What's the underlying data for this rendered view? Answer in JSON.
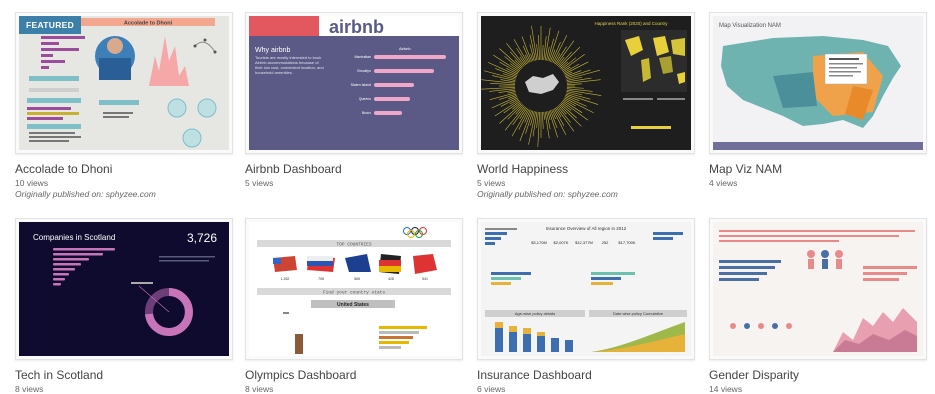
{
  "featured_badge": "FEATURED",
  "cards": [
    {
      "title": "Accolade to Dhoni",
      "views": "10 views",
      "published_label": "Originally published on:",
      "published_site": "sphyzee.com",
      "thumb_text": {
        "heading": "Accolade to Dhoni"
      }
    },
    {
      "title": "Airbnb Dashboard",
      "views": "5 views",
      "thumb_text": {
        "logo": "airbnb",
        "heading": "Why airbnb",
        "body_1": "Tourists are mostly interested to book",
        "body_2": "Airbnb accommodations because of",
        "body_3": "their low cost, convenient location, and",
        "body_4": "household amenities.",
        "chart_title": "Airbnb",
        "bars": [
          "Manhattan",
          "Brooklyn",
          "Staten Island",
          "Queens",
          "Bronx"
        ]
      }
    },
    {
      "title": "World Happiness",
      "views": "5 views",
      "published_label": "Originally published on:",
      "published_site": "sphyzee.com",
      "thumb_text": {
        "heading": "Happiness Rank (2020) and Country"
      }
    },
    {
      "title": "Map Viz NAM",
      "views": "4 views",
      "thumb_text": {
        "heading": "Map Visualization NAM"
      }
    },
    {
      "title": "Tech in Scotland",
      "views": "8 views",
      "thumb_text": {
        "heading": "Companies in Scotland",
        "kpi": "3,726"
      }
    },
    {
      "title": "Olympics Dashboard",
      "views": "8 views",
      "thumb_text": {
        "section_1": "TOP COUNTRIES",
        "section_2": "Find your country stats",
        "country": "United States",
        "medal_counts": [
          "1,262",
          "708",
          "565",
          "428",
          "541"
        ]
      }
    },
    {
      "title": "Insurance Dashboard",
      "views": "6 views",
      "thumb_text": {
        "heading": "Insurance Overview of All region in 2012",
        "panel_1": "Age-wise policy details",
        "panel_2": "Date wise policy Cumulative",
        "kpis": [
          "$3,170M",
          "$2,007K",
          "$12,377M",
          "252",
          "$17,700K"
        ]
      }
    },
    {
      "title": "Gender Disparity",
      "views": "14 views",
      "thumb_text": {}
    }
  ],
  "colors": {
    "badge": "#3c7fa8",
    "airbnb_bg": "#5b5a86",
    "airbnb_bar": "#f0a8c8",
    "happiness_bg": "#1e1e1e",
    "scotland_bg": "#0e0b2e",
    "scotland_accent": "#c874b8"
  }
}
